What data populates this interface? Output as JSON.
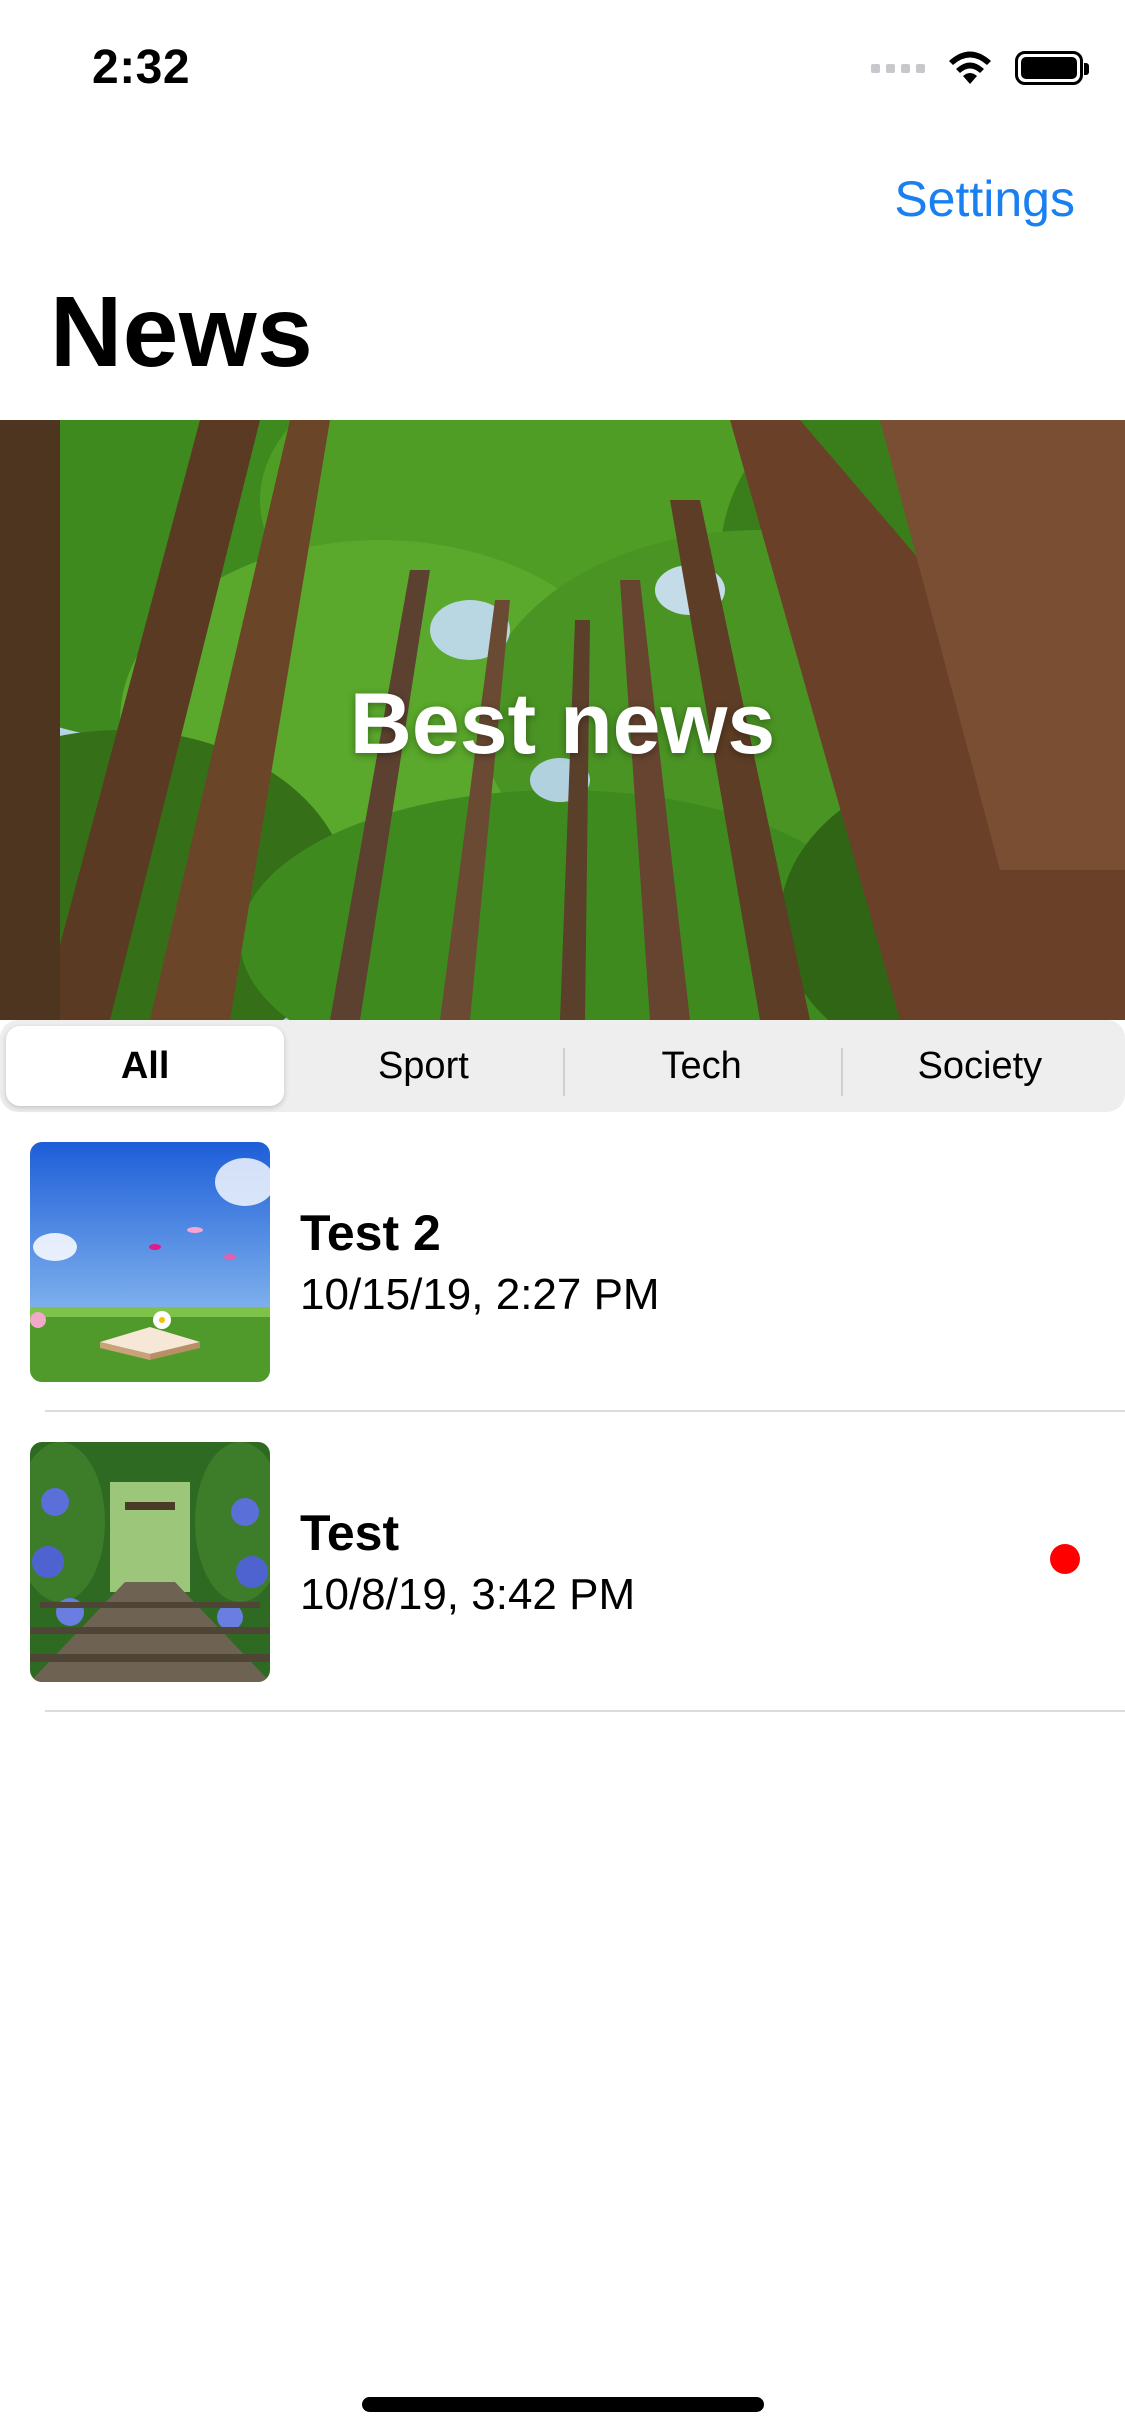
{
  "status_bar": {
    "time": "2:32"
  },
  "nav": {
    "settings_label": "Settings",
    "title": "News"
  },
  "hero": {
    "title": "Best news"
  },
  "segments": [
    {
      "label": "All",
      "selected": true
    },
    {
      "label": "Sport",
      "selected": false
    },
    {
      "label": "Tech",
      "selected": false
    },
    {
      "label": "Society",
      "selected": false
    }
  ],
  "news_items": [
    {
      "title": "Test 2",
      "date": "10/15/19, 2:27 PM",
      "unread": false
    },
    {
      "title": "Test",
      "date": "10/8/19, 3:42 PM",
      "unread": true
    }
  ],
  "colors": {
    "accent": "#1a7ff0",
    "unread": "#ff0000"
  }
}
